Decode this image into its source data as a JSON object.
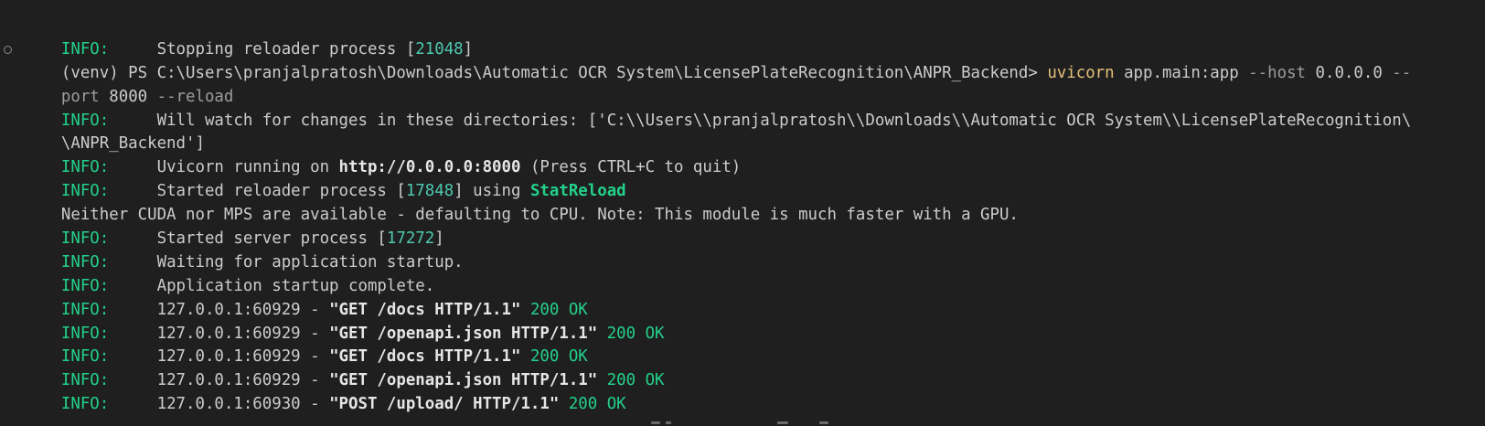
{
  "terminal": {
    "lines": [
      {
        "type": "info",
        "prefix": "INFO:",
        "pre": "     Stopping reloader process [",
        "num": "21048",
        "post": "]"
      },
      {
        "type": "cmd",
        "venv": "(venv) PS ",
        "path": "C:\\Users\\pranjalpratosh\\Downloads\\Automatic OCR System\\LicensePlateRecognition\\ANPR_Backend> ",
        "command": "uvicorn",
        "args": " app.main:app ",
        "flag1": "--host",
        "val1": " 0.0.0.0 ",
        "flag2a": "--"
      },
      {
        "type": "cont",
        "flag2b": "port",
        "val2": " 8000 ",
        "flag3": "--reload"
      },
      {
        "type": "plain",
        "prefix": "INFO:",
        "text": "     Will watch for changes in these directories: ['C:\\\\Users\\\\pranjalpratosh\\\\Downloads\\\\Automatic OCR System\\\\LicensePlateRecognition\\"
      },
      {
        "type": "wrap",
        "text": "\\ANPR_Backend']"
      },
      {
        "type": "uvicorn",
        "prefix": "INFO:",
        "pre": "     Uvicorn running on ",
        "url": "http://0.0.0.0:8000",
        "post": " (Press CTRL+C to quit)"
      },
      {
        "type": "stat",
        "prefix": "INFO:",
        "pre": "     Started reloader process [",
        "num": "17848",
        "mid": "] using ",
        "tool": "StatReload"
      },
      {
        "type": "raw",
        "text": "Neither CUDA nor MPS are available - defaulting to CPU. Note: This module is much faster with a GPU."
      },
      {
        "type": "info",
        "prefix": "INFO:",
        "pre": "     Started server process [",
        "num": "17272",
        "post": "]"
      },
      {
        "type": "plain",
        "prefix": "INFO:",
        "text": "     Waiting for application startup."
      },
      {
        "type": "plain",
        "prefix": "INFO:",
        "text": "     Application startup complete."
      },
      {
        "type": "req",
        "prefix": "INFO:",
        "pre": "     127.0.0.1:60929 - ",
        "request": "\"GET /docs HTTP/1.1\"",
        "status": " 200 OK"
      },
      {
        "type": "req",
        "prefix": "INFO:",
        "pre": "     127.0.0.1:60929 - ",
        "request": "\"GET /openapi.json HTTP/1.1\"",
        "status": " 200 OK"
      },
      {
        "type": "req",
        "prefix": "INFO:",
        "pre": "     127.0.0.1:60929 - ",
        "request": "\"GET /docs HTTP/1.1\"",
        "status": " 200 OK"
      },
      {
        "type": "req",
        "prefix": "INFO:",
        "pre": "     127.0.0.1:60929 - ",
        "request": "\"GET /openapi.json HTTP/1.1\"",
        "status": " 200 OK"
      },
      {
        "type": "req",
        "prefix": "INFO:",
        "pre": "     127.0.0.1:60930 - ",
        "request": "\"POST /upload/ HTTP/1.1\"",
        "status": " 200 OK"
      }
    ]
  },
  "colors": {
    "background": "#1f1f1f",
    "info": "#23d18b",
    "number": "#4ec9b0",
    "command": "#e5c07b",
    "flag": "#9d9d9d",
    "text": "#cccccc"
  }
}
